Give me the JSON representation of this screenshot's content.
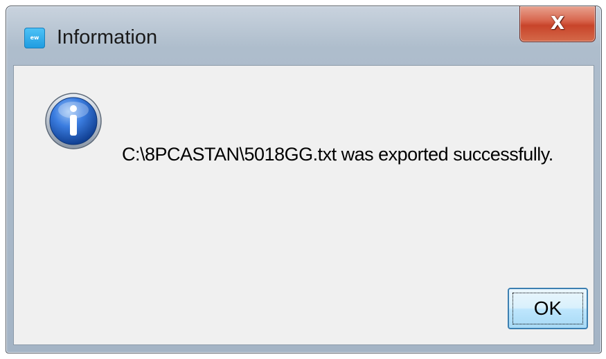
{
  "window": {
    "title": "Information",
    "app_icon_text": "ew",
    "close_label": "X"
  },
  "dialog": {
    "icon": "information-icon",
    "message": "C:\\8PCASTAN\\5018GG.txt was exported successfully.",
    "ok_label": "OK"
  },
  "colors": {
    "title_bar": "#aebdcc",
    "client_bg": "#f0f0f0",
    "close_button": "#c8442a",
    "info_icon_blue": "#1f5fc0",
    "ok_button_border": "#3c7fb1"
  }
}
